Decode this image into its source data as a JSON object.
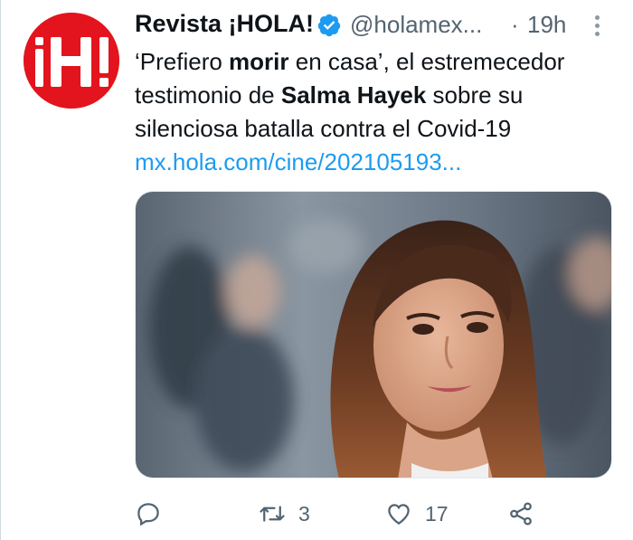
{
  "tweet": {
    "author_name": "Revista ¡HOLA!",
    "handle": "@holamex...",
    "separator": "·",
    "time": "19h",
    "text_1": "‘Prefiero ",
    "text_bold_1": "morir",
    "text_2": " en casa’, el estremecedor testimonio de ",
    "text_bold_2": "Salma Hayek",
    "text_3": " sobre su silenciosa batalla contra el Covid-19",
    "link": "mx.hola.com/cine/202105193..."
  },
  "avatar": {
    "logo_text": "¡H!",
    "color": "#e3141d"
  },
  "actions": {
    "reply_count": "",
    "retweet_count": "3",
    "like_count": "17"
  },
  "colors": {
    "link": "#1d9bf0",
    "secondary": "#536471",
    "verified": "#1d9bf0"
  }
}
